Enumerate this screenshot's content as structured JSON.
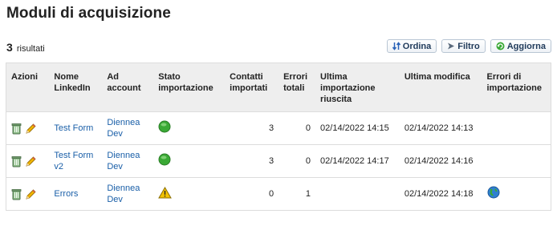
{
  "page": {
    "title": "Moduli di acquisizione"
  },
  "results": {
    "count": "3",
    "label": "risultati"
  },
  "toolbar": {
    "sort_label": "Ordina",
    "filter_label": "Filtro",
    "refresh_label": "Aggiorna"
  },
  "table": {
    "headers": {
      "actions": "Azioni",
      "linkedin_name": "Nome LinkedIn",
      "ad_account": "Ad account",
      "import_status": "Stato importazione",
      "imported_contacts": "Contatti importati",
      "total_errors": "Errori totali",
      "last_successful_import": "Ultima importazione riuscita",
      "last_modified": "Ultima modifica",
      "import_errors": "Errori di importazione"
    },
    "rows": [
      {
        "name": "Test Form",
        "ad_account": "Diennea Dev",
        "status_icon": "green-status-icon",
        "contacts": "3",
        "errors": "0",
        "last_import": "02/14/2022 14:15",
        "last_modified": "02/14/2022 14:13",
        "error_icon": ""
      },
      {
        "name": "Test Form v2",
        "ad_account": "Diennea Dev",
        "status_icon": "green-status-icon",
        "contacts": "3",
        "errors": "0",
        "last_import": "02/14/2022 14:17",
        "last_modified": "02/14/2022 14:16",
        "error_icon": ""
      },
      {
        "name": "Errors",
        "ad_account": "Diennea Dev",
        "status_icon": "warning-icon",
        "contacts": "0",
        "errors": "1",
        "last_import": "",
        "last_modified": "02/14/2022 14:18",
        "error_icon": "globe-icon"
      }
    ]
  },
  "colors": {
    "link": "#1a5fa8",
    "status_ok": "#3aa935",
    "warning": "#f2c200",
    "header_bg": "#eeeeee"
  }
}
